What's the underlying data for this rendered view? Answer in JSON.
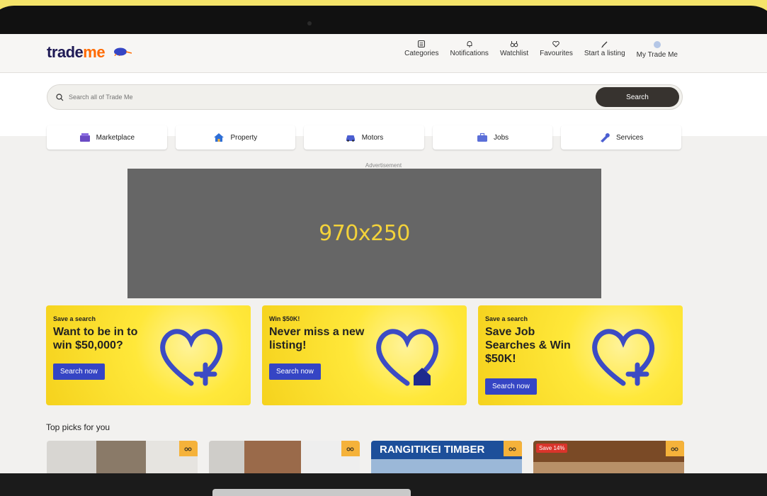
{
  "header": {
    "logo_trade": "trade",
    "logo_me": "me",
    "nav": [
      {
        "label": "Categories",
        "icon": "list-icon"
      },
      {
        "label": "Notifications",
        "icon": "bell-icon"
      },
      {
        "label": "Watchlist",
        "icon": "binoculars-icon"
      },
      {
        "label": "Favourites",
        "icon": "heart-icon"
      },
      {
        "label": "Start a listing",
        "icon": "pencil-icon"
      },
      {
        "label": "My Trade Me",
        "icon": "avatar"
      }
    ]
  },
  "search": {
    "placeholder": "Search all of Trade Me",
    "button": "Search"
  },
  "categories": [
    {
      "label": "Marketplace",
      "icon": "shop-icon",
      "color": "#6b4bc4"
    },
    {
      "label": "Property",
      "icon": "house-icon",
      "color": "#2f6fd6"
    },
    {
      "label": "Motors",
      "icon": "car-icon",
      "color": "#4c5fd1"
    },
    {
      "label": "Jobs",
      "icon": "briefcase-icon",
      "color": "#5b6fd8"
    },
    {
      "label": "Services",
      "icon": "wrench-icon",
      "color": "#4c5fd1"
    }
  ],
  "ad": {
    "label": "Advertisement",
    "size": "970x250"
  },
  "promos": [
    {
      "tag": "Save a search",
      "title": "Want to be in to win $50,000?",
      "button": "Search now"
    },
    {
      "tag": "Win $50K!",
      "title": "Never miss a new listing!",
      "button": "Search now"
    },
    {
      "tag": "Save a search",
      "title": "Save Job Searches & Win $50K!",
      "button": "Search now"
    }
  ],
  "picks": {
    "title": "Top picks for you",
    "items": [
      {
        "badge": "",
        "brand": ""
      },
      {
        "badge": "",
        "brand": ""
      },
      {
        "badge": "",
        "brand": "RANGITIKEI TIMBER"
      },
      {
        "badge": "Save 14%",
        "brand": ""
      }
    ]
  },
  "colors": {
    "accent": "#3545c4",
    "promo_yellow": "#ffe83a",
    "watchlist_tab": "#f5b23a",
    "ad_text": "#f3d23a"
  }
}
